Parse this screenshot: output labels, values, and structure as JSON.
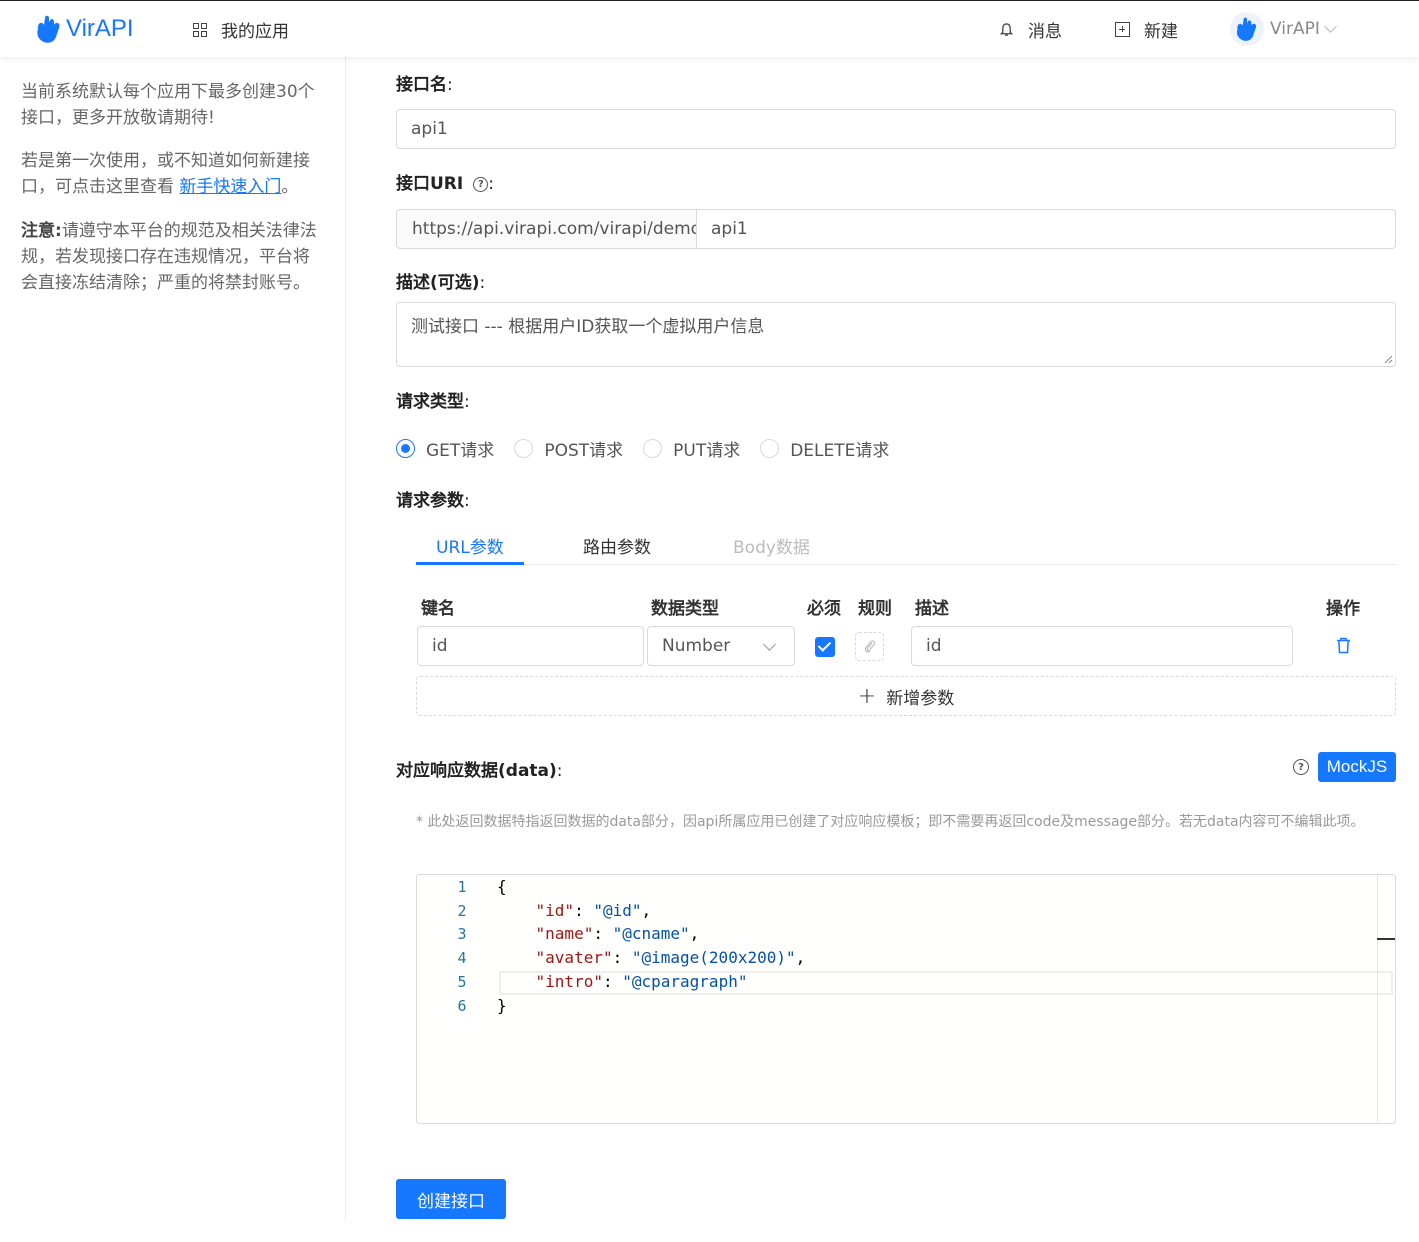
{
  "header": {
    "logo_text": "VirAPI",
    "nav_apps": "我的应用",
    "messages": "消息",
    "new": "新建",
    "user_name": "VirAPI"
  },
  "sidebar": {
    "tip1": "当前系统默认每个应用下最多创建30个接口，更多开放敬请期待!",
    "tip2_prefix": "若是第一次使用，或不知道如何新建接口，可点击这里查看 ",
    "tip2_link": "新手快速入门",
    "tip2_suffix": "。",
    "tip3_label": "注意:",
    "tip3_text": "请遵守本平台的规范及相关法律法规，若发现接口存在违规情况，平台将会直接冻结清除；严重的将禁封账号。"
  },
  "form": {
    "name_label": "接口名",
    "name_value": "api1",
    "uri_label": "接口URI",
    "uri_prefix": "https://api.virapi.com/virapi/demo/",
    "uri_value": "api1",
    "desc_label": "描述(可选)",
    "desc_value": "测试接口 --- 根据用户ID获取一个虚拟用户信息",
    "type_label": "请求类型",
    "types": [
      "GET请求",
      "POST请求",
      "PUT请求",
      "DELETE请求"
    ],
    "params_label": "请求参数",
    "tabs": [
      "URL参数",
      "路由参数",
      "Body数据"
    ],
    "columns": [
      "键名",
      "数据类型",
      "必须",
      "规则",
      "描述",
      "操作"
    ],
    "param_row": {
      "key": "id",
      "type": "Number",
      "required": true,
      "desc": "id"
    },
    "add_param": "新增参数",
    "response_label": "对应响应数据(data)",
    "mock_button": "MockJS",
    "note": "* 此处返回数据特指返回数据的data部分，因api所属应用已创建了对应响应模板；即不需要再返回code及message部分。若无data内容可不编辑此项。",
    "submit": "创建接口"
  },
  "editor": {
    "line_numbers": [
      "1",
      "2",
      "3",
      "4",
      "5",
      "6"
    ],
    "lines": [
      {
        "open": "{"
      },
      {
        "key": "\"id\"",
        "sep": ": ",
        "val": "\"@id\"",
        "end": ","
      },
      {
        "key": "\"name\"",
        "sep": ": ",
        "val": "\"@cname\"",
        "end": ","
      },
      {
        "key": "\"avater\"",
        "sep": ": ",
        "val": "\"@image(200x200)\"",
        "end": ","
      },
      {
        "key": "\"intro\"",
        "sep": ": ",
        "val": "\"@cparagraph\"",
        "end": ""
      },
      {
        "open": "}"
      }
    ]
  },
  "colors": {
    "primary": "#1677ff",
    "json_key": "#a31515",
    "json_string": "#0451a5",
    "line_number": "#237893"
  }
}
